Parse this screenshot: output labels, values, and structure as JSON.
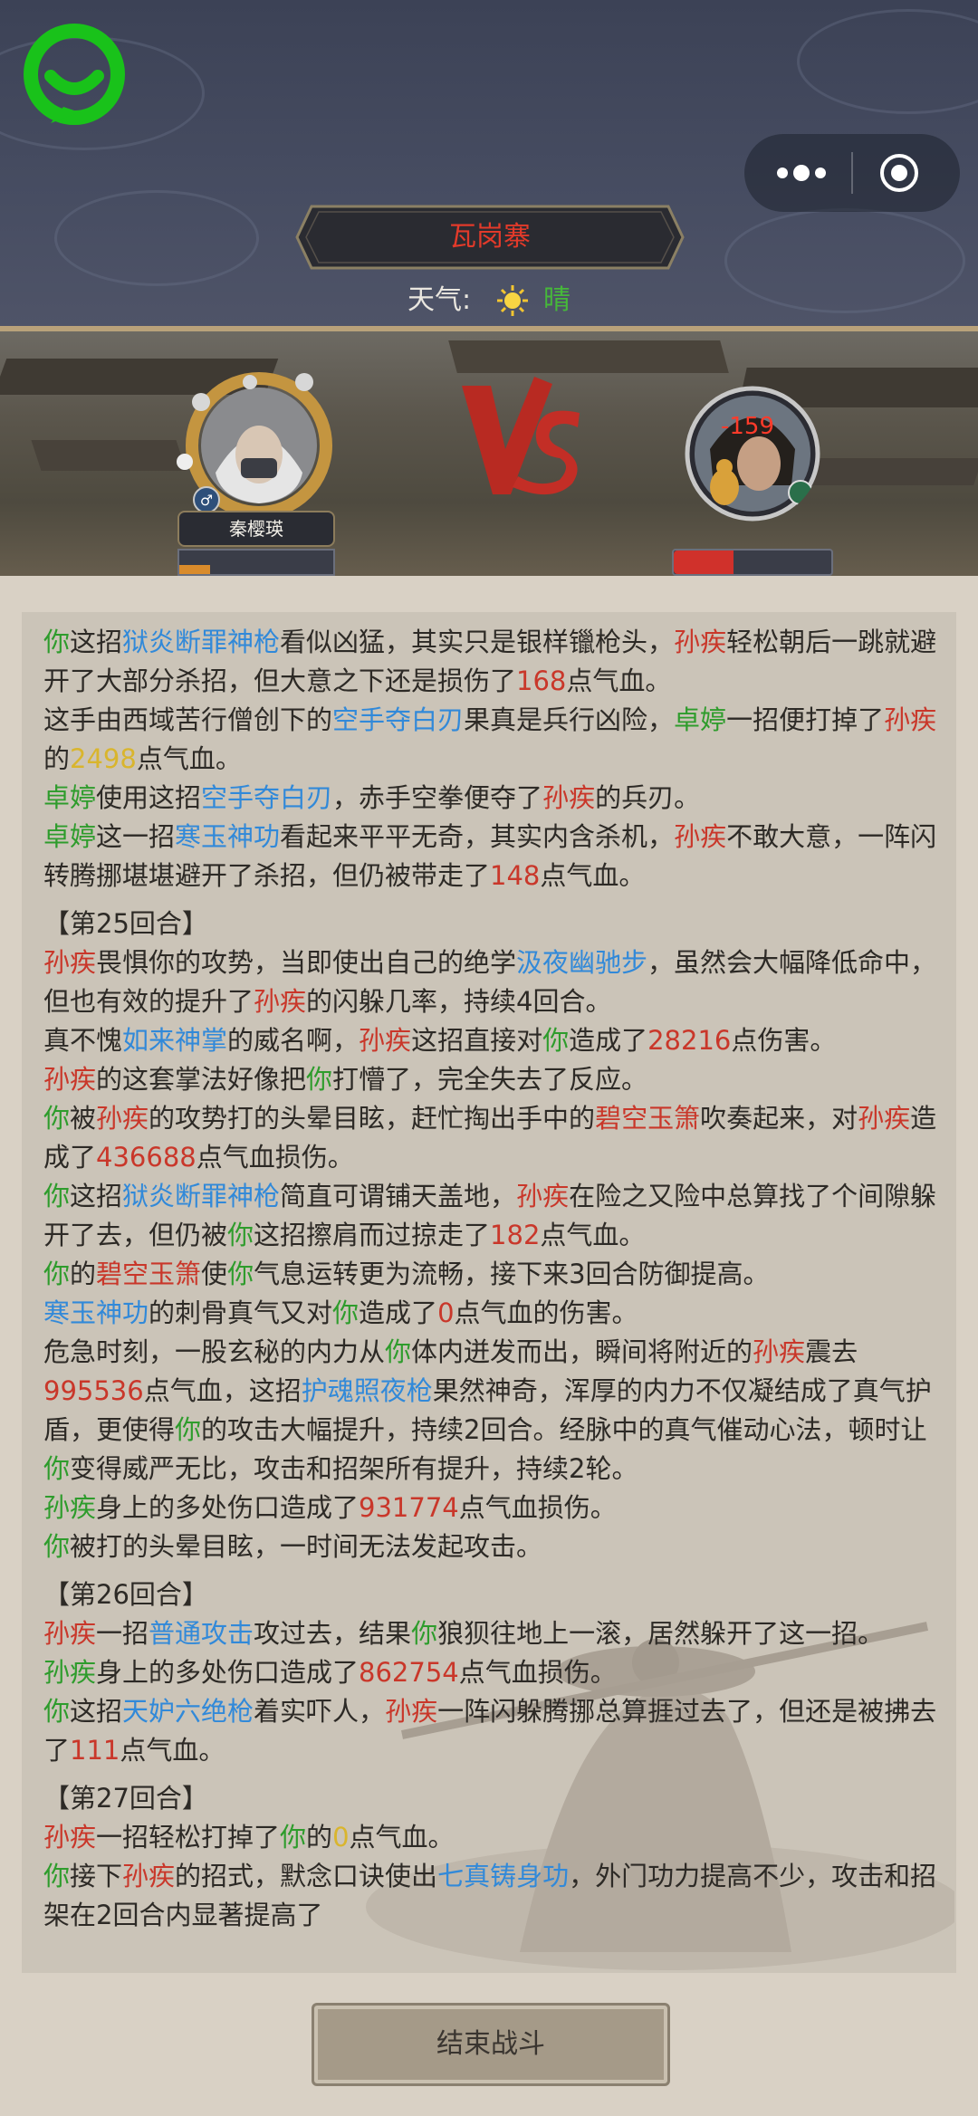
{
  "header": {
    "location": "瓦岗寨",
    "weather_label": "天气:",
    "weather_value": "晴",
    "capsule_icons": [
      "more-icon",
      "record-icon"
    ]
  },
  "battle": {
    "player_name": "秦樱瑛",
    "player_hp_fraction": 0.2,
    "enemy_hp_fraction": 0.38,
    "enemy_damage_popup": "-159",
    "vs_text": "VS",
    "colors": {
      "you": "#2e9c2c",
      "enemy": "#c9372a",
      "skill": "#3189d9",
      "highlight": "#d9b52d"
    }
  },
  "log": {
    "entries": [
      [
        {
          "t": "你",
          "c": "g"
        },
        {
          "t": "这招"
        },
        {
          "t": "狱炎断罪神枪",
          "c": "b"
        },
        {
          "t": "看似凶猛，其实只是银样镴枪头，"
        },
        {
          "t": "孙疾",
          "c": "r"
        },
        {
          "t": "轻松朝后一跳就避开了大部分杀招，但大意之下还是损伤了"
        },
        {
          "t": "168",
          "c": "r"
        },
        {
          "t": "点气血。"
        }
      ],
      [
        {
          "t": "这手由西域苦行僧创下的"
        },
        {
          "t": "空手夺白刃",
          "c": "b"
        },
        {
          "t": "果真是兵行凶险，"
        },
        {
          "t": "卓婷",
          "c": "g"
        },
        {
          "t": "一招便打掉了"
        },
        {
          "t": "孙疾",
          "c": "r"
        },
        {
          "t": "的"
        },
        {
          "t": "2498",
          "c": "y"
        },
        {
          "t": "点气血。"
        }
      ],
      [
        {
          "t": "卓婷",
          "c": "g"
        },
        {
          "t": "使用这招"
        },
        {
          "t": "空手夺白刃",
          "c": "b"
        },
        {
          "t": "，赤手空拳便夺了"
        },
        {
          "t": "孙疾",
          "c": "r"
        },
        {
          "t": "的兵刃。"
        }
      ],
      [
        {
          "t": "卓婷",
          "c": "g"
        },
        {
          "t": "这一招"
        },
        {
          "t": "寒玉神功",
          "c": "b"
        },
        {
          "t": "看起来平平无奇，其实内含杀机，"
        },
        {
          "t": "孙疾",
          "c": "r"
        },
        {
          "t": "不敢大意，一阵闪转腾挪堪堪避开了杀招，但仍被带走了"
        },
        {
          "t": "148",
          "c": "r"
        },
        {
          "t": "点气血。"
        }
      ],
      [
        {
          "t": "【第25回合】",
          "round": true
        }
      ],
      [
        {
          "t": "孙疾",
          "c": "r"
        },
        {
          "t": "畏惧你的攻势，当即使出自己的绝学"
        },
        {
          "t": "汲夜幽驰步",
          "c": "b"
        },
        {
          "t": "，虽然会大幅降低命中，但也有效的提升了"
        },
        {
          "t": "孙疾",
          "c": "r"
        },
        {
          "t": "的闪躲几率，持续4回合。"
        }
      ],
      [
        {
          "t": "真不愧"
        },
        {
          "t": "如来神掌",
          "c": "b"
        },
        {
          "t": "的威名啊，"
        },
        {
          "t": "孙疾",
          "c": "r"
        },
        {
          "t": "这招直接对"
        },
        {
          "t": "你",
          "c": "g"
        },
        {
          "t": "造成了"
        },
        {
          "t": "28216",
          "c": "r"
        },
        {
          "t": "点伤害。"
        }
      ],
      [
        {
          "t": "孙疾",
          "c": "r"
        },
        {
          "t": "的这套掌法好像把"
        },
        {
          "t": "你",
          "c": "g"
        },
        {
          "t": "打懵了，完全失去了反应。"
        }
      ],
      [
        {
          "t": "你",
          "c": "g"
        },
        {
          "t": "被"
        },
        {
          "t": "孙疾",
          "c": "r"
        },
        {
          "t": "的攻势打的头晕目眩，赶忙掏出手中的"
        },
        {
          "t": "碧空玉箫",
          "c": "r"
        },
        {
          "t": "吹奏起来，对"
        },
        {
          "t": "孙疾",
          "c": "r"
        },
        {
          "t": "造成了"
        },
        {
          "t": "436688",
          "c": "r"
        },
        {
          "t": "点气血损伤。"
        }
      ],
      [
        {
          "t": "你",
          "c": "g"
        },
        {
          "t": "这招"
        },
        {
          "t": "狱炎断罪神枪",
          "c": "b"
        },
        {
          "t": "简直可谓铺天盖地，"
        },
        {
          "t": "孙疾",
          "c": "r"
        },
        {
          "t": "在险之又险中总算找了个间隙躲开了去，但仍被"
        },
        {
          "t": "你",
          "c": "g"
        },
        {
          "t": "这招擦肩而过掠走了"
        },
        {
          "t": "182",
          "c": "r"
        },
        {
          "t": "点气血。"
        }
      ],
      [
        {
          "t": "你",
          "c": "g"
        },
        {
          "t": "的"
        },
        {
          "t": "碧空玉箫",
          "c": "r"
        },
        {
          "t": "使"
        },
        {
          "t": "你",
          "c": "g"
        },
        {
          "t": "气息运转更为流畅，接下来3回合防御提高。"
        }
      ],
      [
        {
          "t": "寒玉神功",
          "c": "b"
        },
        {
          "t": "的刺骨真气又对"
        },
        {
          "t": "你",
          "c": "g"
        },
        {
          "t": "造成了"
        },
        {
          "t": "0",
          "c": "r"
        },
        {
          "t": "点气血的伤害。"
        }
      ],
      [
        {
          "t": "危急时刻，一股玄秘的内力从"
        },
        {
          "t": "你",
          "c": "g"
        },
        {
          "t": "体内迸发而出，瞬间将附近的"
        },
        {
          "t": "孙疾",
          "c": "r"
        },
        {
          "t": "震去"
        },
        {
          "t": "995536",
          "c": "r"
        },
        {
          "t": "点气血，这招"
        },
        {
          "t": "护魂照夜枪",
          "c": "b"
        },
        {
          "t": "果然神奇，浑厚的内力不仅凝结成了真气护盾，更使得"
        },
        {
          "t": "你",
          "c": "g"
        },
        {
          "t": "的攻击大幅提升，持续2回合。经脉中的真气催动心法，顿时让"
        },
        {
          "t": "你",
          "c": "g"
        },
        {
          "t": "变得威严无比，攻击和招架所有提升，持续2轮。"
        }
      ],
      [
        {
          "t": "孙疾",
          "c": "g"
        },
        {
          "t": "身上的多处伤口造成了"
        },
        {
          "t": "931774",
          "c": "r"
        },
        {
          "t": "点气血损伤。"
        }
      ],
      [
        {
          "t": "你",
          "c": "g"
        },
        {
          "t": "被打的头晕目眩，一时间无法发起攻击。"
        }
      ],
      [
        {
          "t": "【第26回合】",
          "round": true
        }
      ],
      [
        {
          "t": "孙疾",
          "c": "r"
        },
        {
          "t": "一招"
        },
        {
          "t": "普通攻击",
          "c": "b"
        },
        {
          "t": "攻过去，结果"
        },
        {
          "t": "你",
          "c": "g"
        },
        {
          "t": "狼狈往地上一滚，居然躲开了这一招。"
        }
      ],
      [
        {
          "t": "孙疾",
          "c": "g"
        },
        {
          "t": "身上的多处伤口造成了"
        },
        {
          "t": "862754",
          "c": "r"
        },
        {
          "t": "点气血损伤。"
        }
      ],
      [
        {
          "t": "你",
          "c": "g"
        },
        {
          "t": "这招"
        },
        {
          "t": "天妒六绝枪",
          "c": "b"
        },
        {
          "t": "着实吓人，"
        },
        {
          "t": "孙疾",
          "c": "r"
        },
        {
          "t": "一阵闪躲腾挪总算捱过去了，但还是被拂去了"
        },
        {
          "t": "111",
          "c": "r"
        },
        {
          "t": "点气血。"
        }
      ],
      [
        {
          "t": "【第27回合】",
          "round": true
        }
      ],
      [
        {
          "t": "孙疾",
          "c": "r"
        },
        {
          "t": "一招轻松打掉了"
        },
        {
          "t": "你",
          "c": "g"
        },
        {
          "t": "的"
        },
        {
          "t": "0",
          "c": "y"
        },
        {
          "t": "点气血。"
        }
      ],
      [
        {
          "t": "你",
          "c": "g"
        },
        {
          "t": "接下"
        },
        {
          "t": "孙疾",
          "c": "r"
        },
        {
          "t": "的招式，默念口诀使出"
        },
        {
          "t": "七真铸身功",
          "c": "b"
        },
        {
          "t": "，外门功力提高不少，攻击和招架在2回合内显著提高了"
        }
      ]
    ]
  },
  "footer": {
    "end_button": "结束战斗"
  }
}
